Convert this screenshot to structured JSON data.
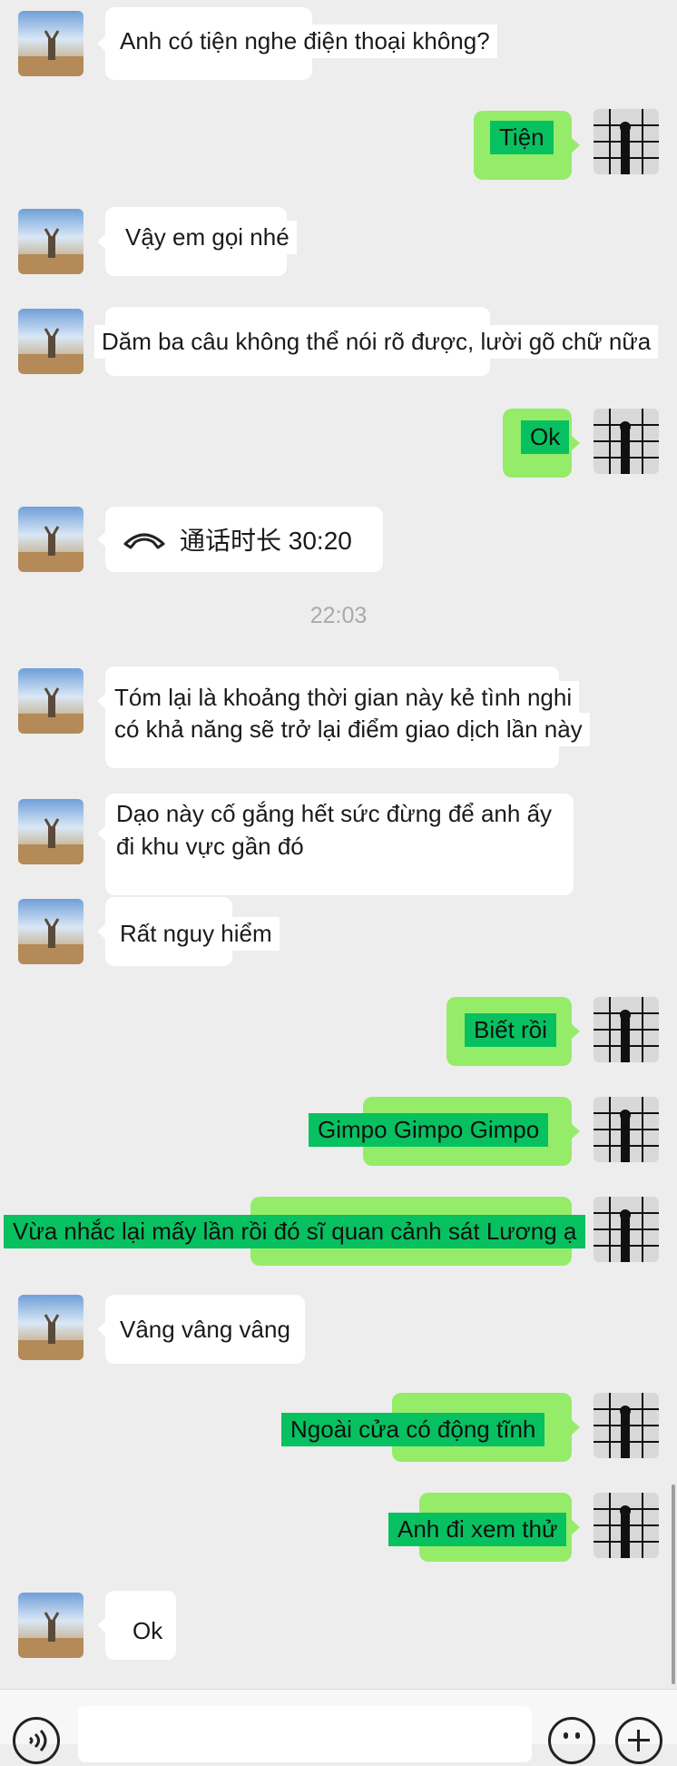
{
  "messages": [
    {
      "side": "in",
      "text": "Anh có tiện nghe điện thoại không?"
    },
    {
      "side": "out",
      "text": "Tiện"
    },
    {
      "side": "in",
      "text": "Vậy em gọi nhé"
    },
    {
      "side": "in",
      "text": "Dăm ba câu không thể nói rõ được, lười gõ chữ nữa"
    },
    {
      "side": "out",
      "text": "Ok"
    },
    {
      "side": "in",
      "type": "call",
      "call_label": "通话时长 30:20",
      "icon": "phone-hangup-icon"
    },
    {
      "side": "in",
      "lines": [
        "Tóm lại là khoảng thời gian này kẻ tình nghi",
        "có khả năng sẽ trở lại điểm giao dịch lần này"
      ]
    },
    {
      "side": "in",
      "lines": [
        "Dạo này cố gắng hết sức đừng để anh ấy",
        "đi khu vực gần đó"
      ]
    },
    {
      "side": "in",
      "text": "Rất nguy hiểm"
    },
    {
      "side": "out",
      "text": "Biết rồi"
    },
    {
      "side": "out",
      "text": "Gimpo Gimpo Gimpo"
    },
    {
      "side": "out",
      "text": "Vừa nhắc lại mấy lần rồi đó sĩ quan cảnh sát Lương ạ"
    },
    {
      "side": "in",
      "text": "Vâng vâng vâng"
    },
    {
      "side": "out",
      "text": "Ngoài cửa có động tĩnh"
    },
    {
      "side": "out",
      "text": "Anh đi xem thử"
    },
    {
      "side": "in",
      "text": "Ok"
    }
  ],
  "timestamp": "22:03",
  "input_bar": {
    "voice_icon": "voice-icon",
    "emoji_icon": "emoji-icon",
    "plus_icon": "plus-icon"
  },
  "colors": {
    "background": "#ededed",
    "incoming_bubble": "#ffffff",
    "outgoing_bubble": "#95ec69",
    "translation_overlay": "#07c160"
  }
}
